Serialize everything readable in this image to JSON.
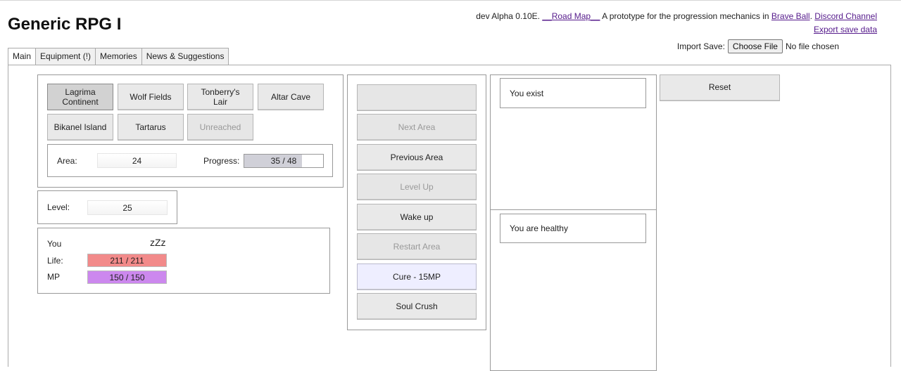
{
  "header": {
    "title": "Generic RPG I",
    "version": "dev Alpha 0.10E.",
    "roadmap_link": "__Road Map__",
    "description": "A prototype for the progression mechanics in",
    "brave_ball_link": "Brave Ball",
    "discord_link": "Discord Channel",
    "export_link": "Export save data",
    "import_label": "Import Save:",
    "choose_file_label": "Choose File",
    "file_status": "No file chosen"
  },
  "tabs": [
    {
      "label": "Main",
      "active": true
    },
    {
      "label": "Equipment (!)"
    },
    {
      "label": "Memories"
    },
    {
      "label": "News & Suggestions"
    }
  ],
  "areas": [
    {
      "label": "Lagrima\nContinent",
      "state": "active"
    },
    {
      "label": "Wolf Fields",
      "state": "normal"
    },
    {
      "label": "Tonberry's\nLair",
      "state": "normal"
    },
    {
      "label": "Altar Cave",
      "state": "normal"
    },
    {
      "label": "Bikanel Island",
      "state": "normal"
    },
    {
      "label": "Tartarus",
      "state": "normal"
    },
    {
      "label": "Unreached",
      "state": "disabled"
    }
  ],
  "area_info": {
    "area_label": "Area:",
    "area_value": "24",
    "progress_label": "Progress:",
    "progress_value": "35 / 48",
    "progress_fraction": 0.73
  },
  "level": {
    "label": "Level:",
    "value": "25"
  },
  "player": {
    "name": "You",
    "status": "zZz",
    "life_label": "Life:",
    "life_value": "211 / 211",
    "life_color": "#f28a8a",
    "mp_label": "MP",
    "mp_value": "150 / 150",
    "mp_color": "#cc88ee"
  },
  "actions": [
    {
      "label": "",
      "state": "disabled"
    },
    {
      "label": "Next Area",
      "state": "disabled"
    },
    {
      "label": "Previous Area",
      "state": "normal"
    },
    {
      "label": "Level Up",
      "state": "disabled"
    },
    {
      "label": "Wake up",
      "state": "normal"
    },
    {
      "label": "Restart Area",
      "state": "disabled"
    },
    {
      "label": "Cure - 15MP",
      "state": "cure"
    },
    {
      "label": "Soul Crush",
      "state": "normal"
    }
  ],
  "messages": {
    "top": "You exist",
    "bottom": "You are healthy"
  },
  "reset_label": "Reset"
}
